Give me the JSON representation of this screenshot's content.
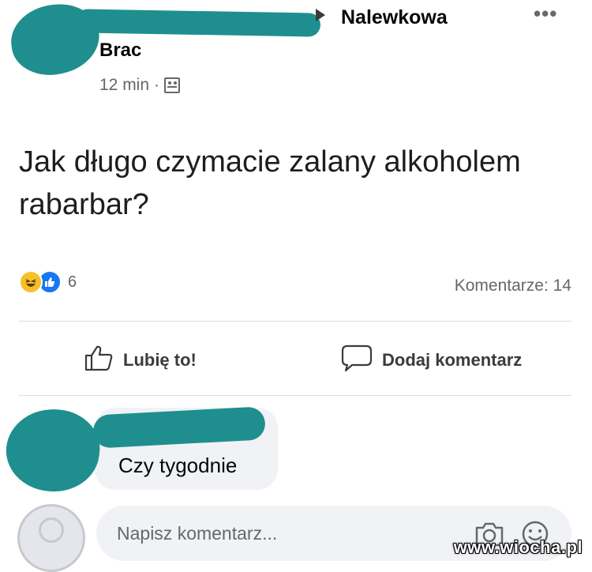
{
  "post": {
    "group_name": "Nalewkowa",
    "author_name": "Brac",
    "time": "12 min",
    "meta_separator": "·",
    "text": "Jak długo czymacie zalany alkoholem rabarbar?",
    "more_label": "•••"
  },
  "reactions": {
    "count": "6",
    "types": [
      "haha-icon",
      "like-icon"
    ],
    "comments_label": "Komentarze: 14"
  },
  "actions": {
    "like_label": "Lubię to!",
    "comment_label": "Dodaj komentarz"
  },
  "comments": [
    {
      "text": "Czy tygodnie"
    }
  ],
  "composer": {
    "placeholder": "Napisz komentarz..."
  },
  "watermark": "www.wiocha.pl",
  "colors": {
    "redaction": "#1f8e8e",
    "like_blue": "#1877f2",
    "secondary_text": "#65676b",
    "bubble": "#f0f2f5"
  }
}
